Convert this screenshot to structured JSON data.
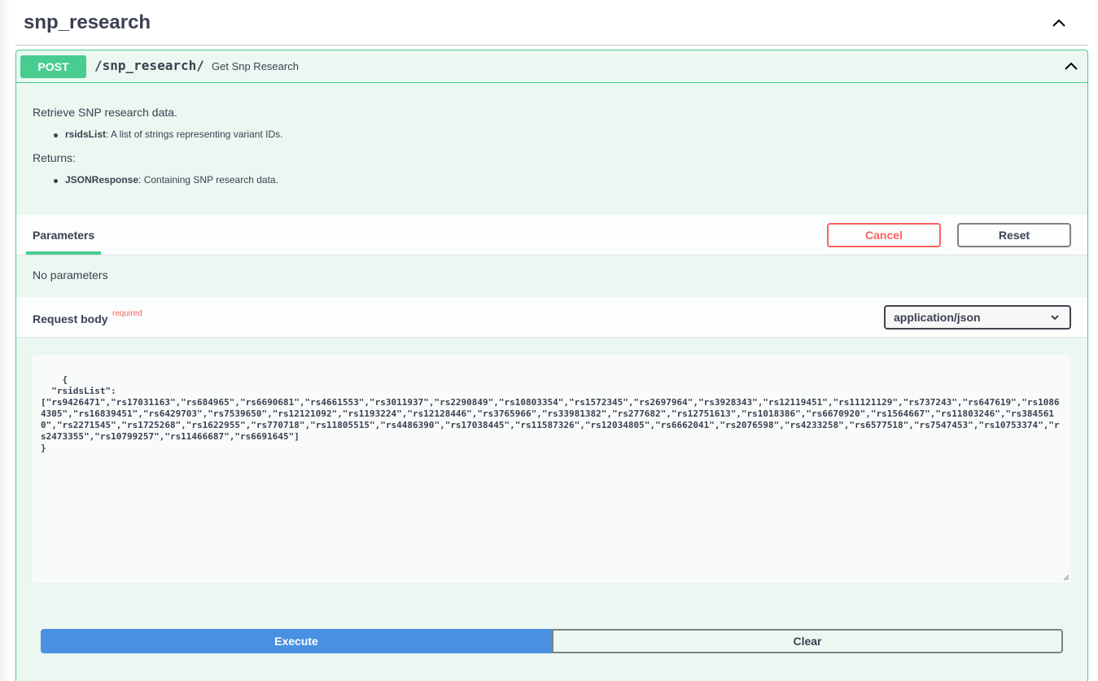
{
  "tag": {
    "title": "snp_research"
  },
  "operation": {
    "method": "POST",
    "path": "/snp_research/",
    "summary": "Get Snp Research",
    "description": {
      "intro": "Retrieve SNP research data.",
      "args": [
        {
          "name": "rsidsList",
          "text": ": A list of strings representing variant IDs."
        }
      ],
      "returns_label": "Returns:",
      "returns": [
        {
          "name": "JSONResponse",
          "text": ": Containing SNP research data."
        }
      ]
    }
  },
  "parameters": {
    "tab_label": "Parameters",
    "cancel_label": "Cancel",
    "reset_label": "Reset",
    "empty_text": "No parameters"
  },
  "request_body": {
    "label": "Request body",
    "required_label": "required",
    "content_type": "application/json",
    "body": "{\n  \"rsidsList\":\n[\"rs9426471\",\"rs17031163\",\"rs684965\",\"rs6690681\",\"rs4661553\",\"rs3011937\",\"rs2290849\",\"rs10803354\",\"rs1572345\",\"rs2697964\",\"rs3928343\",\"rs12119451\",\"rs11121129\",\"rs737243\",\"rs647619\",\"rs10864305\",\"rs16839451\",\"rs6429703\",\"rs7539650\",\"rs12121092\",\"rs1193224\",\"rs12128446\",\"rs3765966\",\"rs33981382\",\"rs277682\",\"rs12751613\",\"rs1018386\",\"rs6670920\",\"rs1564667\",\"rs11803246\",\"rs3845610\",\"rs2271545\",\"rs1725268\",\"rs1622955\",\"rs770718\",\"rs11805515\",\"rs4486390\",\"rs17038445\",\"rs11587326\",\"rs12034805\",\"rs6662041\",\"rs2076598\",\"rs4233258\",\"rs6577518\",\"rs7547453\",\"rs10753374\",\"rs2473355\",\"rs10799257\",\"rs11466687\",\"rs6691645\"]\n}"
  },
  "actions": {
    "execute_label": "Execute",
    "clear_label": "Clear"
  },
  "colors": {
    "post": "#49cc90",
    "cancel": "#ff6060",
    "execute": "#4990e2"
  }
}
